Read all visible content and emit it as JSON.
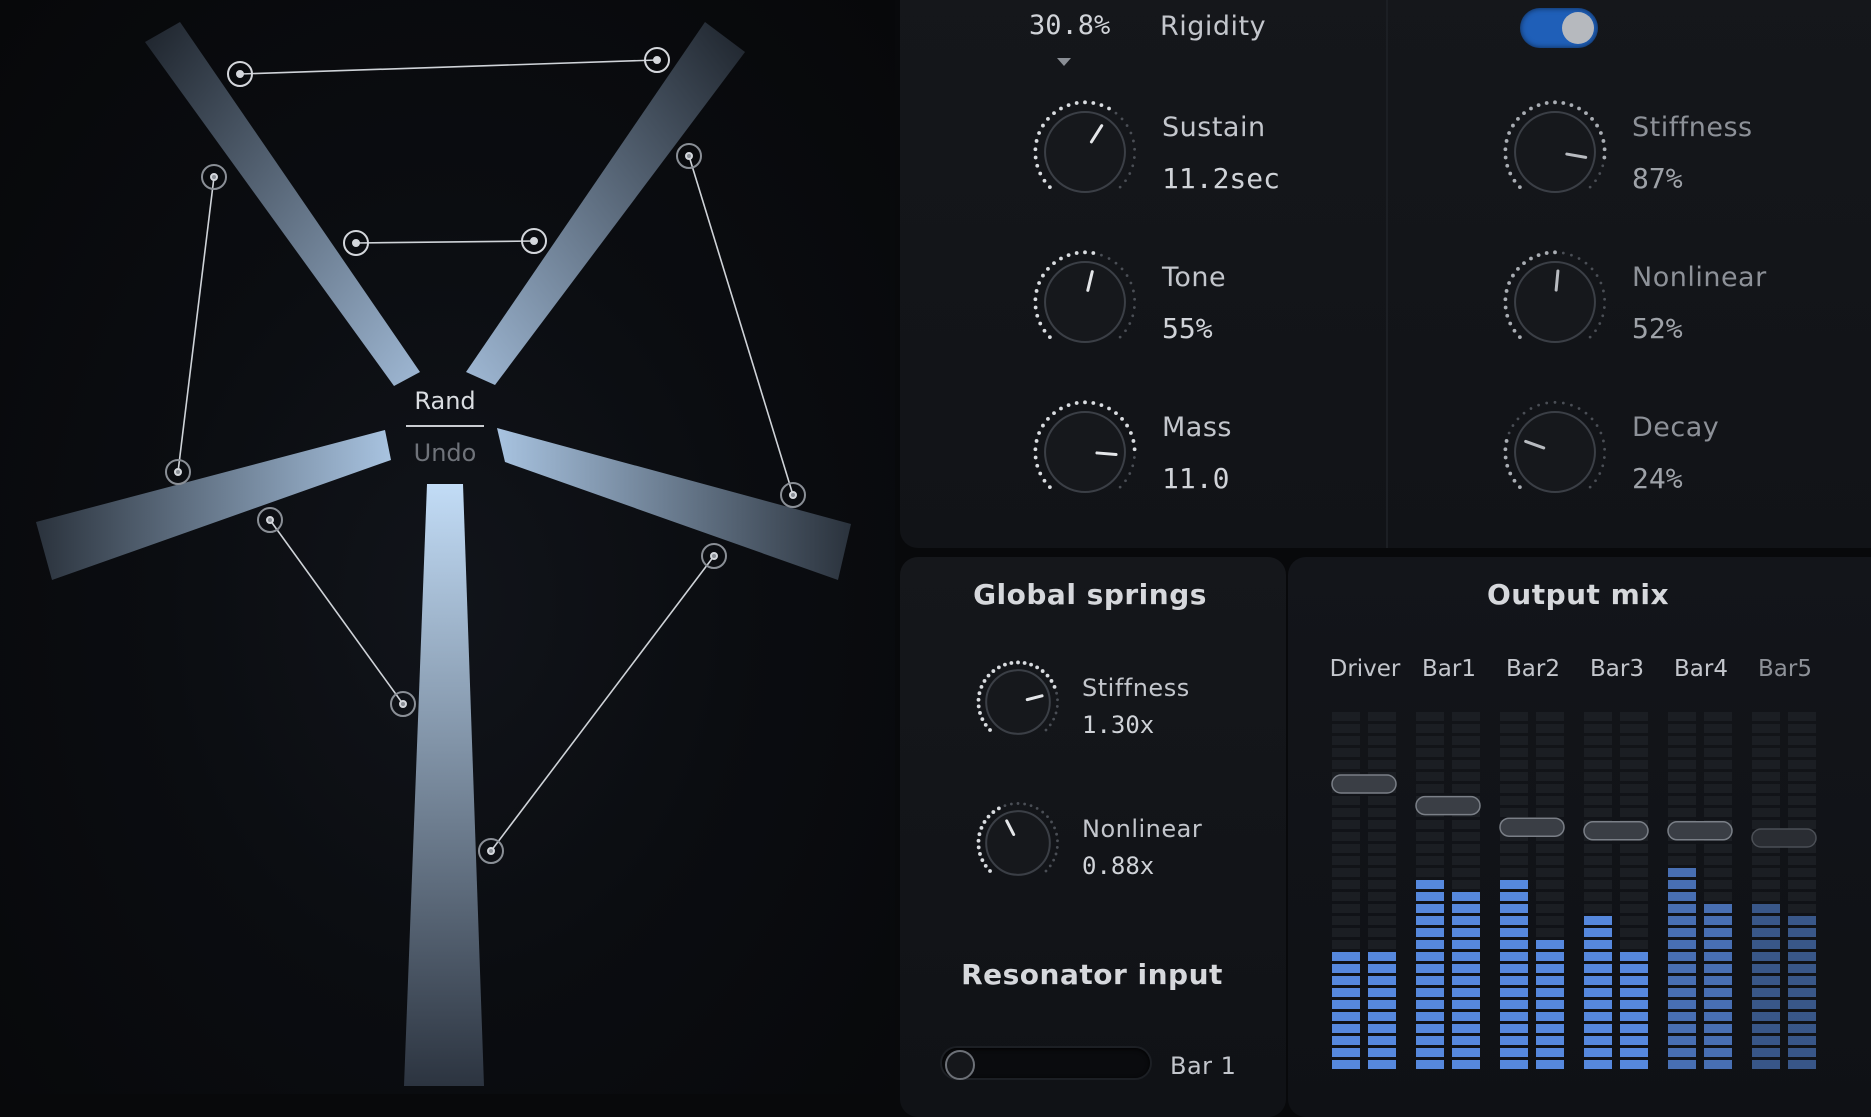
{
  "visualizer": {
    "rand_label": "Rand",
    "undo_label": "Undo"
  },
  "rigidity": {
    "value": "30.8%",
    "label": "Rigidity"
  },
  "toggle": {
    "state": "on",
    "color": "#1f5fb8"
  },
  "bar_params": [
    {
      "label": "Sustain",
      "value": "11.2sec",
      "level": 0.62
    },
    {
      "label": "Tone",
      "value": "55%",
      "level": 0.55
    },
    {
      "label": "Mass",
      "value": "11.0",
      "level": 0.85
    }
  ],
  "spring_params": [
    {
      "label": "Stiffness",
      "value": "87%",
      "level": 0.87
    },
    {
      "label": "Nonlinear",
      "value": "52%",
      "level": 0.52
    },
    {
      "label": "Decay",
      "value": "24%",
      "level": 0.24
    }
  ],
  "global_springs": {
    "title": "Global springs",
    "items": [
      {
        "label": "Stiffness",
        "value": "1.30x",
        "level": 0.78
      },
      {
        "label": "Nonlinear",
        "value": "0.88x",
        "level": 0.4
      }
    ]
  },
  "resonator_input": {
    "title": "Resonator input",
    "selected": "Bar 1"
  },
  "output_mix": {
    "title": "Output mix",
    "channels": [
      {
        "name": "Driver",
        "fader": 0.8,
        "meter_l": 0.36,
        "meter_r": 0.36
      },
      {
        "name": "Bar1",
        "fader": 0.74,
        "meter_l": 0.55,
        "meter_r": 0.52
      },
      {
        "name": "Bar2",
        "fader": 0.68,
        "meter_l": 0.55,
        "meter_r": 0.39
      },
      {
        "name": "Bar3",
        "fader": 0.67,
        "meter_l": 0.45,
        "meter_r": 0.36
      },
      {
        "name": "Bar4",
        "fader": 0.67,
        "meter_l": 0.59,
        "meter_r": 0.49
      },
      {
        "name": "Bar5",
        "fader": 0.65,
        "meter_l": 0.49,
        "meter_r": 0.45
      }
    ],
    "meter_color": "#5b8fe8"
  }
}
